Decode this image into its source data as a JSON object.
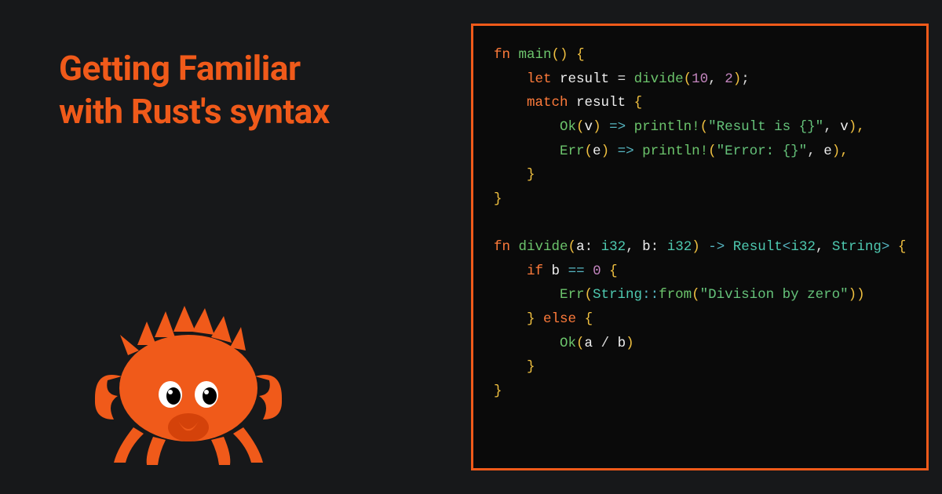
{
  "title_line1": "Getting Familiar",
  "title_line2": "with Rust's syntax",
  "colors": {
    "accent": "#f05a1a",
    "bg": "#17181a",
    "code_bg": "#0a0a0a"
  },
  "code": {
    "l1": {
      "kw": "fn",
      "fn": "main",
      "p1": "()",
      "b1": "{"
    },
    "l2": {
      "kw": "let",
      "var": "result",
      "eq": "=",
      "fn": "divide",
      "p1": "(",
      "n1": "10",
      "c": ",",
      "n2": "2",
      "p2": ")",
      "sc": ";"
    },
    "l3": {
      "kw": "match",
      "var": "result",
      "b": "{"
    },
    "l4": {
      "ok": "Ok",
      "p1": "(",
      "v": "v",
      "p2": ")",
      "ar": "=>",
      "mac": "println!",
      "p3": "(",
      "str": "\"Result is {}\"",
      "c": ",",
      "v2": "v",
      "p4": "),"
    },
    "l5": {
      "err": "Err",
      "p1": "(",
      "e": "e",
      "p2": ")",
      "ar": "=>",
      "mac": "println!",
      "p3": "(",
      "str": "\"Error: {}\"",
      "c": ",",
      "e2": "e",
      "p4": "),"
    },
    "l6": {
      "b": "}"
    },
    "l7": {
      "b": "}"
    },
    "l8": "",
    "l9": {
      "kw": "fn",
      "fn": "divide",
      "p1": "(",
      "a": "a",
      "col1": ":",
      "t1": "i32",
      "c": ",",
      "b": "b",
      "col2": ":",
      "t2": "i32",
      "p2": ")",
      "ar": "->",
      "res": "Result",
      "lt": "<",
      "t3": "i32",
      "c2": ",",
      "t4": "String",
      "gt": ">",
      "br": "{"
    },
    "l10": {
      "kw": "if",
      "var": "b",
      "eq": "==",
      "n": "0",
      "b": "{"
    },
    "l11": {
      "err": "Err",
      "p1": "(",
      "ty": "String",
      "cc": "::",
      "fn": "from",
      "p2": "(",
      "str": "\"Division by zero\"",
      "p3": "))"
    },
    "l12": {
      "b": "}",
      "kw": "else",
      "b2": "{"
    },
    "l13": {
      "ok": "Ok",
      "p1": "(",
      "a": "a",
      "op": "/",
      "b": "b",
      "p2": ")"
    },
    "l14": {
      "b": "}"
    },
    "l15": {
      "b": "}"
    }
  }
}
